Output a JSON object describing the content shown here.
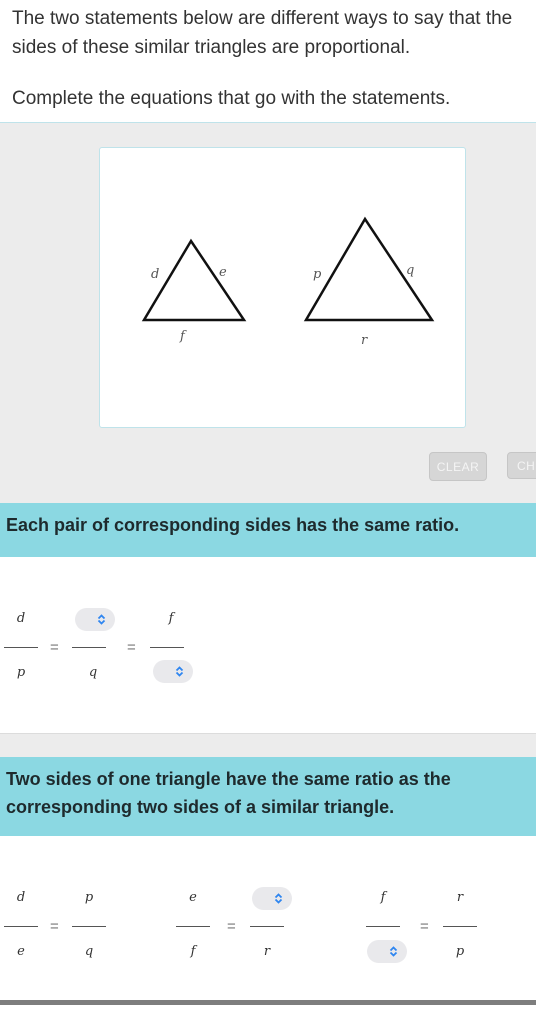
{
  "intro": {
    "line1": "The two statements below are different ways to say that the sides of these similar triangles are proportional.",
    "line2": "Complete the equations that go with the statements."
  },
  "figure": {
    "small_triangle": {
      "side_left": "d",
      "side_right": "e",
      "side_bottom": "f"
    },
    "large_triangle": {
      "side_left": "p",
      "side_right": "q",
      "side_bottom": "r"
    }
  },
  "buttons": {
    "clear": "CLEAR",
    "check": "CHECK"
  },
  "section1": {
    "statement": "Each pair of corresponding sides has the same ratio.",
    "fractions": [
      {
        "numerator": "d",
        "denominator": "p"
      },
      {
        "numerator": null,
        "denominator": "q",
        "numerator_select": "",
        "numerator_is_select": true
      },
      {
        "numerator": "f",
        "denominator": null,
        "denominator_select": "",
        "denominator_is_select": true
      }
    ],
    "equals": "="
  },
  "section2": {
    "statement": "Two sides of one triangle have the same ratio as the corresponding two sides of a similar triangle.",
    "groups": [
      {
        "left": {
          "numerator": "d",
          "denominator": "e"
        },
        "right": {
          "numerator": "p",
          "denominator": "q"
        }
      },
      {
        "left": {
          "numerator": "e",
          "denominator": "f"
        },
        "right": {
          "numerator": null,
          "denominator": "r",
          "numerator_select": ""
        }
      },
      {
        "left": {
          "numerator": "f",
          "denominator": null,
          "denominator_select": ""
        },
        "right": {
          "numerator": "r",
          "denominator": "p"
        }
      }
    ],
    "equals": "="
  },
  "icons": {
    "select": "up-down-chevron-icon"
  },
  "colors": {
    "banner": "#8bd8e2",
    "select_chevron": "#2f86f0",
    "stage_bg": "#ececec",
    "button_bg": "#d6d6d6"
  }
}
